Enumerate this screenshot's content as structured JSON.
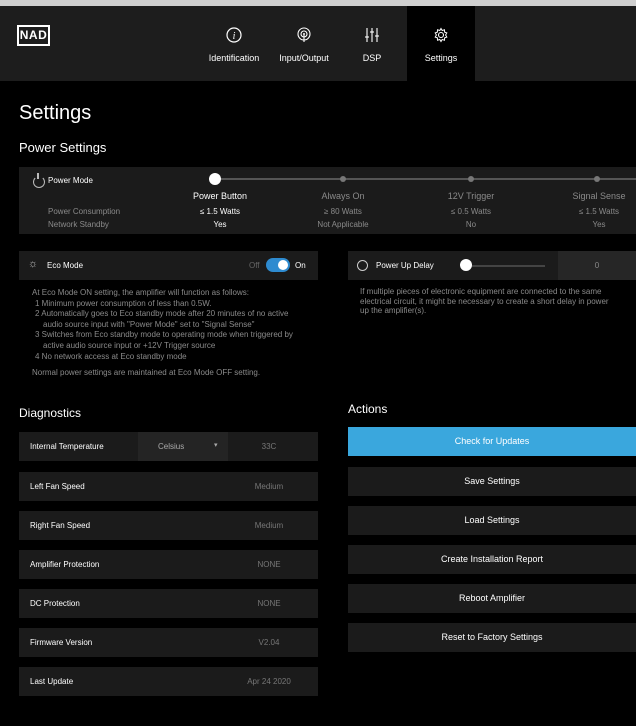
{
  "brand": "NAD",
  "nav": {
    "tabs": [
      {
        "label": "Identification",
        "icon": "info-icon"
      },
      {
        "label": "Input/Output",
        "icon": "broadcast-icon"
      },
      {
        "label": "DSP",
        "icon": "sliders-icon"
      },
      {
        "label": "Settings",
        "icon": "gear-icon",
        "active": true
      }
    ]
  },
  "page_title": "Settings",
  "power_settings": {
    "heading": "Power Settings",
    "power_mode": {
      "label": "Power Mode",
      "row_labels": {
        "consumption": "Power Consumption",
        "standby": "Network Standby"
      },
      "selected_index": 0,
      "options": [
        {
          "name": "Power Button",
          "consumption": "≤ 1.5 Watts",
          "standby": "Yes"
        },
        {
          "name": "Always On",
          "consumption": "≥ 80 Watts",
          "standby": "Not Applicable"
        },
        {
          "name": "12V Trigger",
          "consumption": "≤ 0.5 Watts",
          "standby": "No"
        },
        {
          "name": "Signal Sense",
          "consumption": "≤ 1.5 Watts",
          "standby": "Yes"
        }
      ]
    },
    "eco_mode": {
      "label": "Eco Mode",
      "off_label": "Off",
      "on_label": "On",
      "state": "On",
      "description_intro": "At Eco Mode ON setting, the amplifier will function as follows:",
      "points": [
        "1 Minimum power consumption of less than 0.5W.",
        "2 Automatically goes to Eco standby mode after 20 minutes of no active",
        "audio source input with \"Power Mode\" set to \"Signal Sense\"",
        "3 Switches from Eco standby mode to operating mode when triggered by",
        "active audio source input or +12V Trigger source",
        "4 No network access at Eco standby mode"
      ],
      "description_outro": "Normal power settings are maintained at Eco Mode OFF setting."
    },
    "power_up_delay": {
      "label": "Power Up Delay",
      "value": "0",
      "description": [
        "If multiple pieces of electronic equipment are connected to the same",
        "electrical circuit, it might be necessary to create a short delay in power",
        "up the amplifier(s)."
      ]
    }
  },
  "diagnostics": {
    "heading": "Diagnostics",
    "temperature": {
      "label": "Internal Temperature",
      "unit": "Celsius",
      "value": "33C"
    },
    "rows": [
      {
        "label": "Left Fan Speed",
        "value": "Medium"
      },
      {
        "label": "Right Fan Speed",
        "value": "Medium"
      },
      {
        "label": "Amplifier Protection",
        "value": "NONE"
      },
      {
        "label": "DC Protection",
        "value": "NONE"
      },
      {
        "label": "Firmware Version",
        "value": "V2.04"
      },
      {
        "label": "Last Update",
        "value": "Apr 24 2020"
      }
    ]
  },
  "actions": {
    "heading": "Actions",
    "buttons": [
      "Check for Updates",
      "Save Settings",
      "Load Settings",
      "Create Installation Report",
      "Reboot Amplifier",
      "Reset to Factory Settings"
    ]
  },
  "colors": {
    "accent": "#3aa7dd",
    "toggle": "#2e8bd0",
    "panel": "#1b1b1b",
    "header": "#1d1d1d"
  }
}
